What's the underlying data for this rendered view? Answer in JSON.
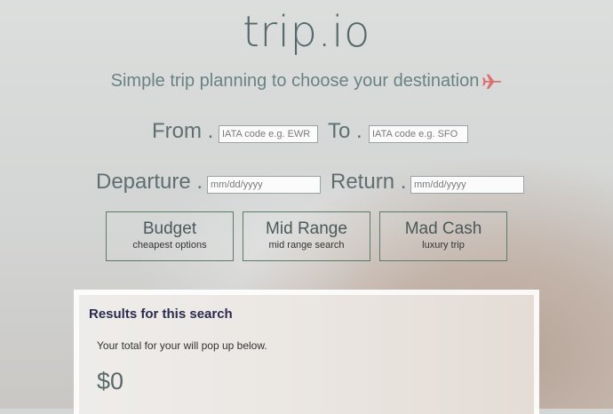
{
  "header": {
    "title": "trip.io",
    "subtitle": "Simple trip planning to choose your destination",
    "subtitle_icon": "airplane-icon"
  },
  "form": {
    "from_label": "From .",
    "from_placeholder": "IATA code e.g. EWR",
    "to_label": "To .",
    "to_placeholder": "IATA code e.g. SFO",
    "departure_label": "Departure .",
    "departure_placeholder": "mm/dd/yyyy",
    "return_label": "Return .",
    "return_placeholder": "mm/dd/yyyy"
  },
  "options": [
    {
      "label": "Budget",
      "sub": "cheapest options"
    },
    {
      "label": "Mid Range",
      "sub": "mid range search"
    },
    {
      "label": "Mad Cash",
      "sub": "luxury trip"
    }
  ],
  "results": {
    "heading": "Results for this search",
    "note": "Your total for your will pop up below.",
    "total": "$0"
  },
  "colors": {
    "accent_plane": "#d9706f",
    "title": "#56696a",
    "button_border": "#5d7a68",
    "results_heading": "#2b2b4f"
  }
}
